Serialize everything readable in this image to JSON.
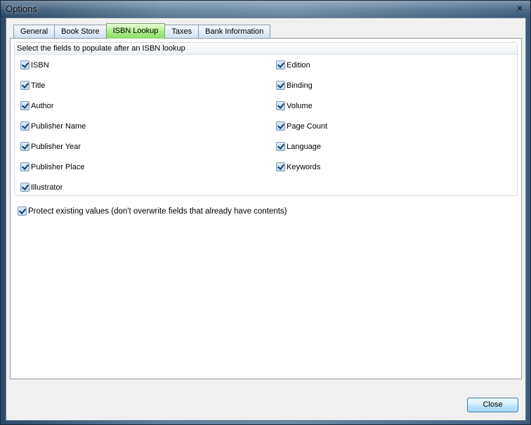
{
  "window": {
    "title": "Options",
    "close_glyph": "✕"
  },
  "tabs": [
    {
      "label": "General",
      "active": false
    },
    {
      "label": "Book Store",
      "active": false
    },
    {
      "label": "ISBN Lookup",
      "active": true
    },
    {
      "label": "Taxes",
      "active": false
    },
    {
      "label": "Bank Information",
      "active": false
    }
  ],
  "group": {
    "title": "Select the fields to populate after an ISBN lookup",
    "left_fields": [
      {
        "label": "ISBN",
        "checked": true
      },
      {
        "label": "Title",
        "checked": true
      },
      {
        "label": "Author",
        "checked": true
      },
      {
        "label": "Publisher Name",
        "checked": true
      },
      {
        "label": "Publisher Year",
        "checked": true
      },
      {
        "label": "Publisher Place",
        "checked": true
      },
      {
        "label": "Illustrator",
        "checked": true
      }
    ],
    "right_fields": [
      {
        "label": "Edition",
        "checked": true
      },
      {
        "label": "Binding",
        "checked": true
      },
      {
        "label": "Volume",
        "checked": true
      },
      {
        "label": "Page Count",
        "checked": true
      },
      {
        "label": "Language",
        "checked": true
      },
      {
        "label": "Keywords",
        "checked": true
      }
    ]
  },
  "protect": {
    "label": "Protect existing values (don't overwrite fields that already have contents)",
    "checked": true
  },
  "buttons": {
    "close_label": "Close"
  },
  "colors": {
    "active_tab": "#8edc6a",
    "tab": "#dde9f6",
    "client_bg": "#f0f0f0",
    "check": "#1c3d66"
  }
}
